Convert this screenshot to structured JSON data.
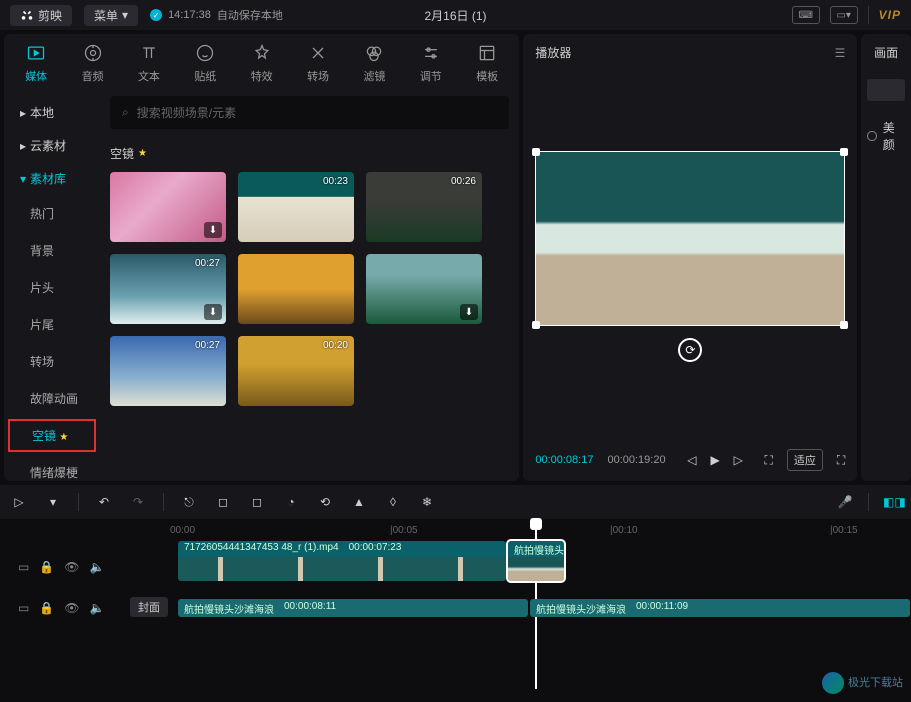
{
  "topbar": {
    "app_name": "剪映",
    "menu_label": "菜单",
    "autosave_time": "14:17:38",
    "autosave_text": "自动保存本地",
    "project_title": "2月16日 (1)",
    "vip": "VIP"
  },
  "tabs": [
    {
      "label": "媒体",
      "active": true
    },
    {
      "label": "音频"
    },
    {
      "label": "文本"
    },
    {
      "label": "贴纸"
    },
    {
      "label": "特效"
    },
    {
      "label": "转场"
    },
    {
      "label": "滤镜"
    },
    {
      "label": "调节"
    },
    {
      "label": "模板"
    }
  ],
  "side_nav": {
    "local": "本地",
    "cloud": "云素材",
    "library": "素材库",
    "subs": [
      {
        "label": "热门"
      },
      {
        "label": "背景"
      },
      {
        "label": "片头"
      },
      {
        "label": "片尾"
      },
      {
        "label": "转场"
      },
      {
        "label": "故障动画"
      },
      {
        "label": "空镜",
        "selected": true,
        "star": true
      },
      {
        "label": "情绪爆梗"
      }
    ]
  },
  "search": {
    "placeholder": "搜索视频场景/元素"
  },
  "section_title": "空镜",
  "assets": [
    {
      "duration": "",
      "bg": "bg-flowers"
    },
    {
      "duration": "00:23",
      "bg": "bg-beach1"
    },
    {
      "duration": "00:26",
      "bg": "bg-forest"
    },
    {
      "duration": "00:27",
      "bg": "bg-wave"
    },
    {
      "duration": "",
      "bg": "bg-autumn"
    },
    {
      "duration": "",
      "bg": "bg-mountain"
    },
    {
      "duration": "00:27",
      "bg": "bg-sky"
    },
    {
      "duration": "00:20",
      "bg": "bg-trees"
    }
  ],
  "preview": {
    "title": "播放器",
    "current_time": "00:00:08:17",
    "total_time": "00:00:19:20",
    "fit_label": "适应"
  },
  "right_panel": {
    "tab1": "画面",
    "label_beauty": "美颜"
  },
  "ruler_marks": [
    "00:00",
    "|00:05",
    "|00:10",
    "|00:15"
  ],
  "timeline": {
    "cover_label": "封面",
    "clip1": {
      "name": "71726054441347453 48_r (1).mp4",
      "dur": "00:00:07:23"
    },
    "clip2": {
      "name": "航拍慢镜头"
    },
    "audio1": {
      "name": "航拍慢镜头沙滩海浪",
      "dur": "00:00:08:11"
    },
    "audio2": {
      "name": "航拍慢镜头沙滩海浪",
      "dur": "00:00:11:09"
    }
  },
  "watermark": "极光下载站"
}
